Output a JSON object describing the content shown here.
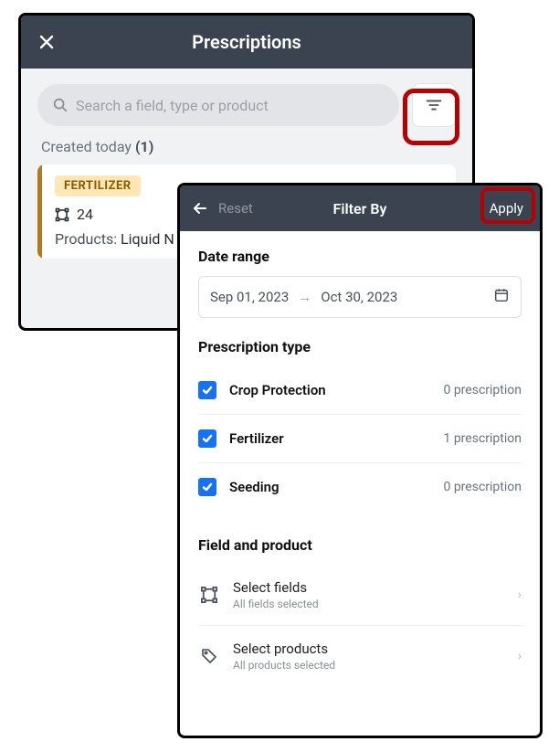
{
  "back": {
    "title": "Prescriptions",
    "search_placeholder": "Search a field, type or product",
    "section_label": "Created today",
    "section_count": "(1)",
    "card": {
      "tag": "FERTILIZER",
      "count": "24",
      "products_label": "Products:",
      "products_value": "Liquid N"
    }
  },
  "filter": {
    "title": "Filter By",
    "reset": "Reset",
    "apply": "Apply",
    "date_label": "Date range",
    "date_from": "Sep 01, 2023",
    "date_to": "Oct 30, 2023",
    "type_label": "Prescription type",
    "types": [
      {
        "name": "Crop Protection",
        "count": "0 prescription"
      },
      {
        "name": "Fertilizer",
        "count": "1 prescription"
      },
      {
        "name": "Seeding",
        "count": "0 prescription"
      }
    ],
    "fp_label": "Field and product",
    "fields": {
      "title": "Select fields",
      "sub": "All fields selected"
    },
    "products": {
      "title": "Select products",
      "sub": "All products selected"
    }
  }
}
